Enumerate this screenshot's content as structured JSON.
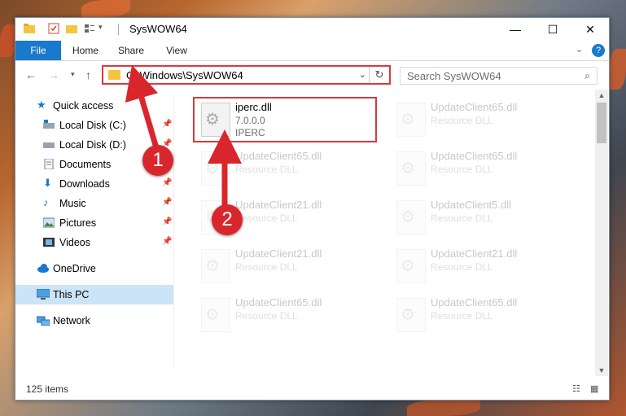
{
  "window": {
    "title": "SysWOW64"
  },
  "window_buttons": {
    "minimize": "—",
    "maximize": "☐",
    "close": "✕"
  },
  "ribbon": {
    "tabs": [
      "File",
      "Home",
      "Share",
      "View"
    ]
  },
  "address": {
    "path": "C:\\Windows\\SysWOW64"
  },
  "search": {
    "placeholder": "Search SysWOW64"
  },
  "sidebar": {
    "items": [
      {
        "label": "Quick access",
        "icon": "star-icon"
      },
      {
        "label": "Local Disk (C:)",
        "icon": "drive-icon"
      },
      {
        "label": "Local Disk (D:)",
        "icon": "drive-icon"
      },
      {
        "label": "Documents",
        "icon": "documents-icon"
      },
      {
        "label": "Downloads",
        "icon": "download-icon"
      },
      {
        "label": "Music",
        "icon": "music-icon"
      },
      {
        "label": "Pictures",
        "icon": "pictures-icon"
      },
      {
        "label": "Videos",
        "icon": "videos-icon"
      },
      {
        "label": "OneDrive",
        "icon": "cloud-icon"
      },
      {
        "label": "This PC",
        "icon": "computer-icon"
      },
      {
        "label": "Network",
        "icon": "network-icon"
      }
    ]
  },
  "files": [
    {
      "name": "iperc.dll",
      "version": "7.0.0.0",
      "desc": "IPERC"
    },
    {
      "name": "UpdateClient65.dll",
      "desc": "Resource DLL"
    },
    {
      "name": "UpdateClient65.dll",
      "desc": "Resource DLL"
    },
    {
      "name": "UpdateClient65.dll",
      "desc": "Resource DLL"
    },
    {
      "name": "UpdateClient21.dll",
      "desc": "Resource DLL"
    },
    {
      "name": "UpdateClient5.dll",
      "desc": "Resource DLL"
    },
    {
      "name": "UpdateClient21.dll",
      "desc": "Resource DLL"
    },
    {
      "name": "UpdateClient21.dll",
      "desc": "Resource DLL"
    },
    {
      "name": "UpdateClient65.dll",
      "desc": "Resource DLL"
    },
    {
      "name": "UpdateClient65.dll",
      "desc": "Resource DLL"
    }
  ],
  "status": {
    "count": "125 items"
  },
  "annotations": {
    "step1": "1",
    "step2": "2"
  },
  "colors": {
    "accent": "#1979ca",
    "highlight": "#e0373a",
    "selected": "#cce4f7"
  }
}
